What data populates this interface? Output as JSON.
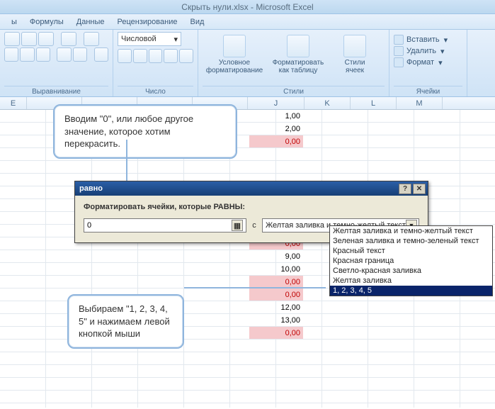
{
  "app": {
    "title": "Скрыть нули.xlsx - Microsoft Excel"
  },
  "ribbon_tabs": [
    "ы",
    "Формулы",
    "Данные",
    "Рецензирование",
    "Вид"
  ],
  "ribbon_groups": {
    "alignment": "Выравнивание",
    "number": "Число",
    "styles": "Стили",
    "cells": "Ячейки"
  },
  "number_format": "Числовой",
  "styles_buttons": {
    "conditional": "Условное\nформатирование",
    "as_table": "Форматировать\nкак таблицу",
    "cell_styles": "Стили\nячеек"
  },
  "cells_actions": {
    "insert": "Вставить",
    "delete": "Удалить",
    "format": "Формат"
  },
  "columns": [
    "E",
    "",
    "",
    "",
    "",
    "J",
    "K",
    "L",
    "M"
  ],
  "data_cells": [
    {
      "v": "1,00",
      "z": false
    },
    {
      "v": "2,00",
      "z": false
    },
    {
      "v": "0,00",
      "z": true
    },
    {
      "v": "",
      "z": false
    },
    {
      "v": "",
      "z": false
    },
    {
      "v": "",
      "z": false
    },
    {
      "v": "",
      "z": false
    },
    {
      "v": "",
      "z": false
    },
    {
      "v": "",
      "z": false
    },
    {
      "v": "",
      "z": false
    },
    {
      "v": "0,00",
      "z": true
    },
    {
      "v": "9,00",
      "z": false
    },
    {
      "v": "10,00",
      "z": false
    },
    {
      "v": "0,00",
      "z": true
    },
    {
      "v": "0,00",
      "z": true
    },
    {
      "v": "12,00",
      "z": false
    },
    {
      "v": "13,00",
      "z": false
    },
    {
      "v": "0,00",
      "z": true
    }
  ],
  "callout_top": "Вводим \"0\", или любое другое значение, которое хотим перекрасить.",
  "callout_bottom": "Выбираем \"1, 2, 3, 4, 5\" и нажимаем левой кнопкой мыши",
  "dialog": {
    "title": "равно",
    "label": "Форматировать ячейки, которые РАВНЫ:",
    "value": "0",
    "sep": "с",
    "combo_value": "Желтая заливка и темно-желтый текст",
    "options": [
      "Желтая заливка и темно-желтый текст",
      "Зеленая заливка и темно-зеленый текст",
      "Красный текст",
      "Красная граница",
      "Светло-красная заливка",
      "Желтая заливка",
      "1, 2, 3, 4, 5"
    ],
    "selected_index": 6
  }
}
